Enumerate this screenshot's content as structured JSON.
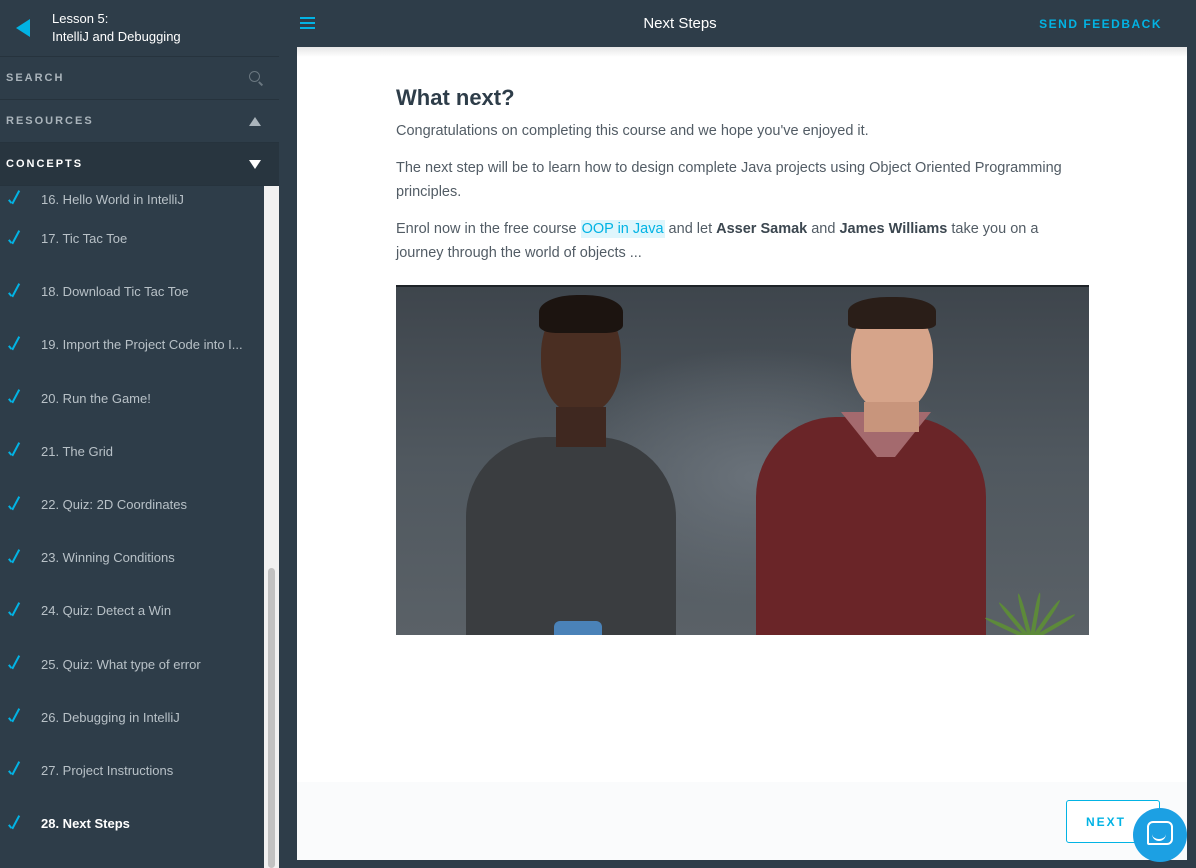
{
  "sidebar": {
    "lesson_number": "Lesson 5:",
    "lesson_name": "IntelliJ and Debugging",
    "search_label": "SEARCH",
    "resources_label": "RESOURCES",
    "concepts_label": "CONCEPTS",
    "concepts": [
      {
        "label": "16. Hello World in IntelliJ",
        "completed": true
      },
      {
        "label": "17. Tic Tac Toe",
        "completed": true
      },
      {
        "label": "18. Download Tic Tac Toe",
        "completed": true
      },
      {
        "label": "19. Import the Project Code into I...",
        "completed": true
      },
      {
        "label": "20. Run the Game!",
        "completed": true
      },
      {
        "label": "21. The Grid",
        "completed": true
      },
      {
        "label": "22. Quiz: 2D Coordinates",
        "completed": true
      },
      {
        "label": "23. Winning Conditions",
        "completed": true
      },
      {
        "label": "24. Quiz: Detect a Win",
        "completed": true
      },
      {
        "label": "25. Quiz: What type of error",
        "completed": true
      },
      {
        "label": "26. Debugging in IntelliJ",
        "completed": true
      },
      {
        "label": "27. Project Instructions",
        "completed": true
      },
      {
        "label": "28. Next Steps",
        "completed": true,
        "active": true
      }
    ]
  },
  "header": {
    "title": "Next Steps",
    "feedback_label": "SEND FEEDBACK"
  },
  "main": {
    "heading": "What next?",
    "para1": "Congratulations on completing this course and we hope you've enjoyed it.",
    "para2": "The next step will be to learn how to design complete Java projects using Object Oriented Programming principles.",
    "para3_pre": "Enrol now in the free course ",
    "para3_link": "OOP in Java",
    "para3_mid1": " and let ",
    "para3_name1": "Asser Samak",
    "para3_mid2": " and ",
    "para3_name2": "James Williams",
    "para3_post": " take you on a journey through the world of objects ..."
  },
  "footer": {
    "next_label": "NEXT"
  },
  "colors": {
    "accent": "#02b3e4",
    "sidebar_bg": "#2e3d49"
  }
}
